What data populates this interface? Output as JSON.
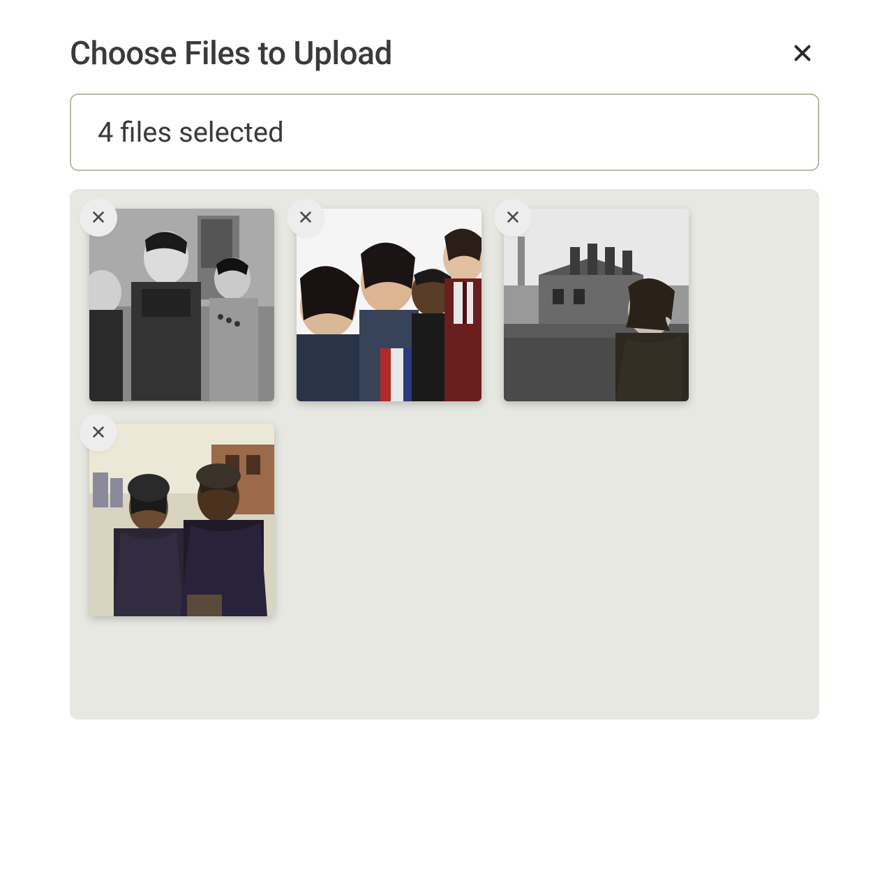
{
  "dialog": {
    "title": "Choose Files to Upload",
    "selection_text": "4 files selected",
    "file_count": 4
  },
  "thumbnails": [
    {
      "alt": "black and white band photo"
    },
    {
      "alt": "color band group photo"
    },
    {
      "alt": "black and white rooftop portrait"
    },
    {
      "alt": "two people in jackets outdoors"
    }
  ]
}
